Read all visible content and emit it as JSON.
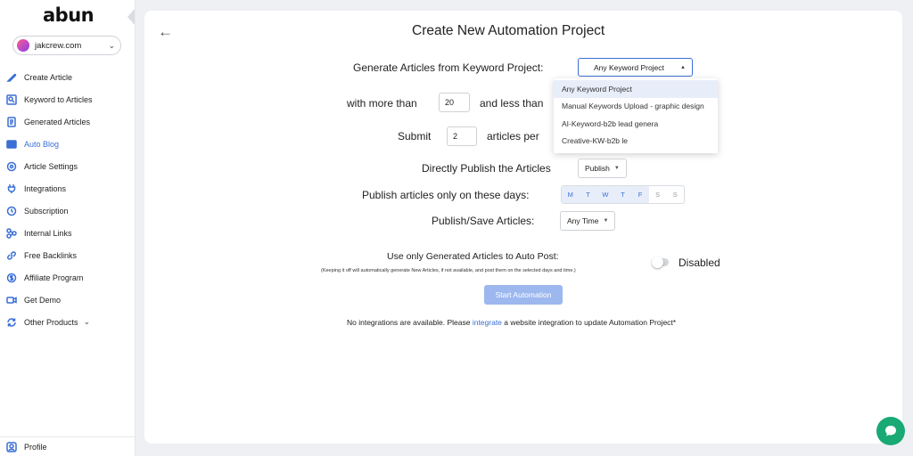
{
  "app": {
    "logo": "abun",
    "account": "jakcrew.com"
  },
  "sidebar": {
    "items": [
      {
        "label": "Create Article",
        "icon": "feather-icon"
      },
      {
        "label": "Keyword to Articles",
        "icon": "keyword-search-icon"
      },
      {
        "label": "Generated Articles",
        "icon": "document-icon"
      },
      {
        "label": "Auto Blog",
        "icon": "auto-blog-icon",
        "active": true
      },
      {
        "label": "Article Settings",
        "icon": "settings-icon"
      },
      {
        "label": "Integrations",
        "icon": "plug-icon"
      },
      {
        "label": "Subscription",
        "icon": "subscription-icon"
      },
      {
        "label": "Internal Links",
        "icon": "link-icon"
      },
      {
        "label": "Free Backlinks",
        "icon": "backlinks-icon"
      },
      {
        "label": "Affiliate Program",
        "icon": "dollar-icon"
      },
      {
        "label": "Get Demo",
        "icon": "video-icon"
      },
      {
        "label": "Other Products",
        "icon": "refresh-icon"
      }
    ],
    "profile": "Profile"
  },
  "main": {
    "title": "Create New Automation Project",
    "generate_label": "Generate Articles from Keyword Project:",
    "keyword_select": "Any Keyword Project",
    "dropdown_options": [
      "Any Keyword Project",
      "Manual Keywords Upload - graphic design",
      "AI-Keyword-b2b lead genera",
      "Creative-KW-b2b le"
    ],
    "more_than_label": "with more than",
    "more_than_value": "20",
    "less_than_label": "and less than",
    "submit_label": "Submit",
    "submit_value": "2",
    "articles_per_label": "articles per",
    "publish_label": "Directly Publish the Articles",
    "publish_select": "Publish",
    "days_label": "Publish articles only on these days:",
    "days": [
      "M",
      "T",
      "W",
      "T",
      "F",
      "S",
      "S"
    ],
    "days_enabled": [
      true,
      true,
      true,
      true,
      true,
      false,
      false
    ],
    "save_label": "Publish/Save Articles:",
    "time_select": "Any Time",
    "autopost_label": "Use only Generated Articles to Auto Post:",
    "autopost_note": "(Keeping it off will automatically generate New Articles, if not available, and post them on the selected days and time.)",
    "toggle_label": "Disabled",
    "start_button": "Start Automation",
    "integration_note_pre": "No integrations are available. Please",
    "integration_link": "integrate",
    "integration_note_post": "a website integration to update Automation Project*"
  },
  "colors": {
    "accent": "#3b6fd6",
    "chat": "#19a974",
    "button_disabled": "#9db8ef"
  }
}
